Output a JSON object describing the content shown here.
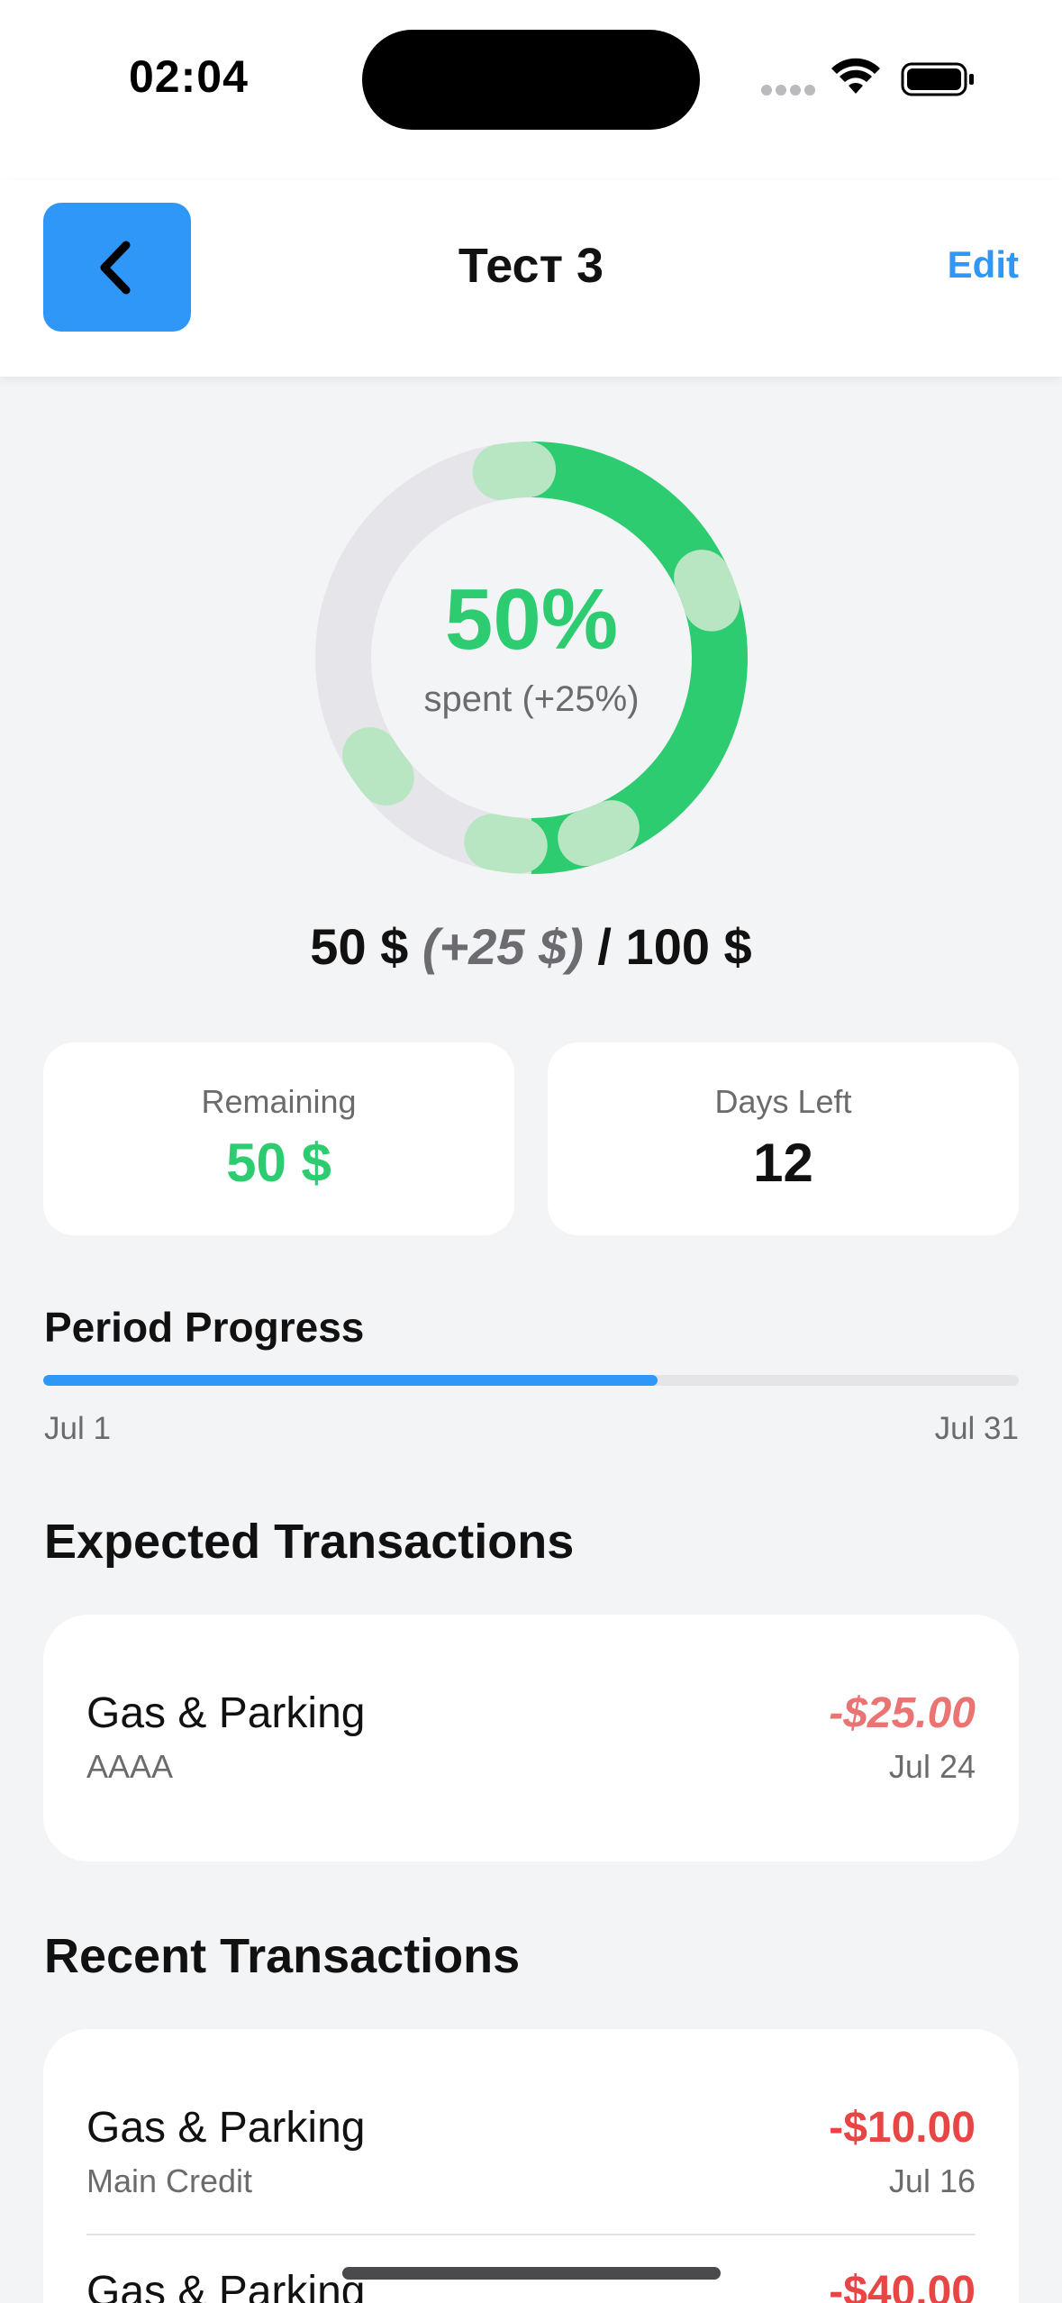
{
  "status_bar": {
    "time": "02:04",
    "icons": [
      "signal-icon",
      "wifi-icon",
      "battery-icon"
    ]
  },
  "nav": {
    "back_icon": "chevron-left-icon",
    "title": "Тест 3",
    "edit_label": "Edit"
  },
  "summary": {
    "percent": "50%",
    "spent_label": "spent (+25%)",
    "spent_fraction": 0.5,
    "pending_fraction": 0.25,
    "amount_spent": "50 $",
    "amount_pending": "(+25 $)",
    "amount_separator": "/",
    "amount_total": "100 $"
  },
  "stats": [
    {
      "label": "Remaining",
      "value": "50 $"
    },
    {
      "label": "Days Left",
      "value": "12"
    }
  ],
  "period": {
    "title": "Period Progress",
    "start": "Jul 1",
    "end": "Jul 31",
    "progress_fraction": 0.63
  },
  "expected": {
    "title": "Expected Transactions",
    "items": [
      {
        "name": "Gas & Parking",
        "account": "AAAA",
        "amount": "-$25.00",
        "date": "Jul 24"
      }
    ]
  },
  "recent": {
    "title": "Recent Transactions",
    "items": [
      {
        "name": "Gas & Parking",
        "account": "Main Credit",
        "amount": "-$10.00",
        "date": "Jul 16"
      },
      {
        "name": "Gas & Parking",
        "amount": "-$40.00"
      }
    ]
  },
  "colors": {
    "accent": "#2f97f8",
    "spent_green": "#2ecc71",
    "pending_green": "#b9e6c2",
    "ring_track": "#e5e5ea",
    "negative_red": "#e84545"
  }
}
